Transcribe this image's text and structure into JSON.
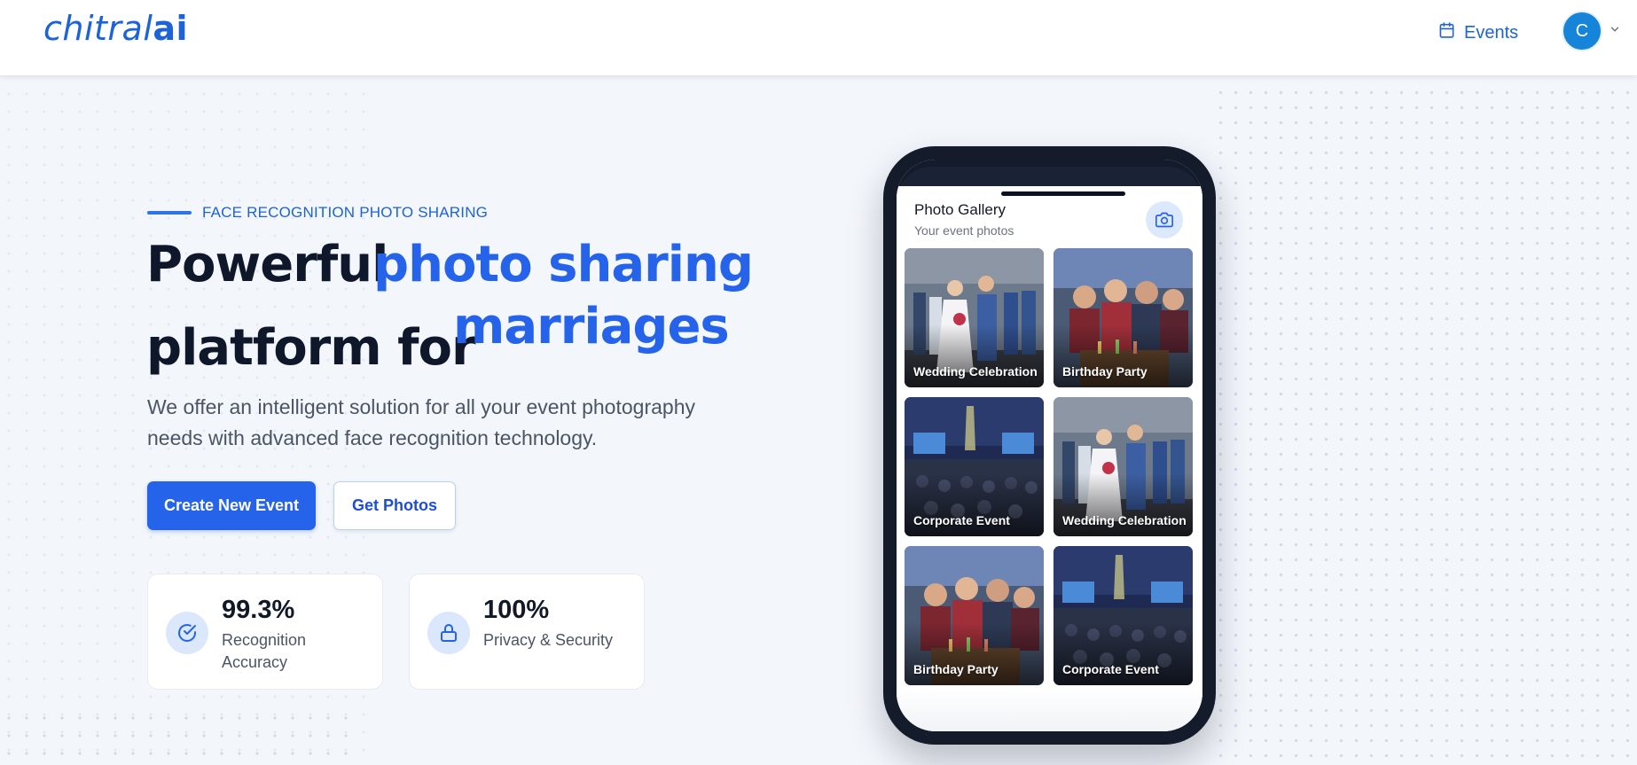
{
  "header": {
    "logo_part1": "chitral",
    "logo_part2": "ai",
    "events_label": "Events",
    "avatar_initial": "C"
  },
  "hero": {
    "eyebrow": "FACE RECOGNITION PHOTO SHARING",
    "headline_dark_1": "Powerful",
    "headline_blue_1": "photo sharing",
    "headline_dark_2": "platform for",
    "headline_blue_2": "marriages",
    "description": "We offer an intelligent solution for all your event photography needs with advanced face recognition technology.",
    "primary_button": "Create New Event",
    "secondary_button": "Get Photos"
  },
  "stats": [
    {
      "value": "99.3%",
      "label": "Recognition Accuracy",
      "icon": "check-circle-icon"
    },
    {
      "value": "100%",
      "label": "Privacy & Security",
      "icon": "lock-icon"
    }
  ],
  "phone": {
    "title": "Photo Gallery",
    "subtitle": "Your event photos",
    "photos": [
      {
        "label": "Wedding Celebration",
        "kind": "wedding"
      },
      {
        "label": "Birthday Party",
        "kind": "birthday"
      },
      {
        "label": "Corporate Event",
        "kind": "corporate"
      },
      {
        "label": "Wedding Celebration",
        "kind": "wedding"
      },
      {
        "label": "Birthday Party",
        "kind": "birthday"
      },
      {
        "label": "Corporate Event",
        "kind": "corporate"
      }
    ]
  },
  "colors": {
    "brand": "#2563eb",
    "dark_text": "#0f172a",
    "background": "#f3f6fb",
    "avatar": "#1684d8"
  }
}
